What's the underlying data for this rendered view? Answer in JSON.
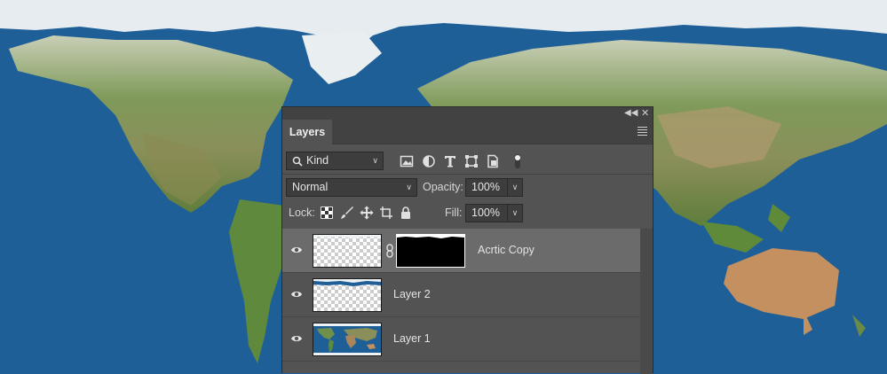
{
  "panel": {
    "tab": "Layers",
    "filter": {
      "label": "Kind"
    },
    "blend_mode": "Normal",
    "opacity": {
      "label": "Opacity:",
      "value": "100%"
    },
    "lock": {
      "label": "Lock:"
    },
    "fill": {
      "label": "Fill:",
      "value": "100%"
    },
    "layers": [
      {
        "name": "Acrtic Copy",
        "selected": true,
        "has_mask": true
      },
      {
        "name": "Layer 2",
        "selected": false,
        "has_mask": false
      },
      {
        "name": "Layer 1",
        "selected": false,
        "has_mask": false
      }
    ]
  },
  "colors": {
    "ocean": "#1f5f98",
    "panel_bg": "#535353",
    "selected_row": "#6b6b6b"
  }
}
